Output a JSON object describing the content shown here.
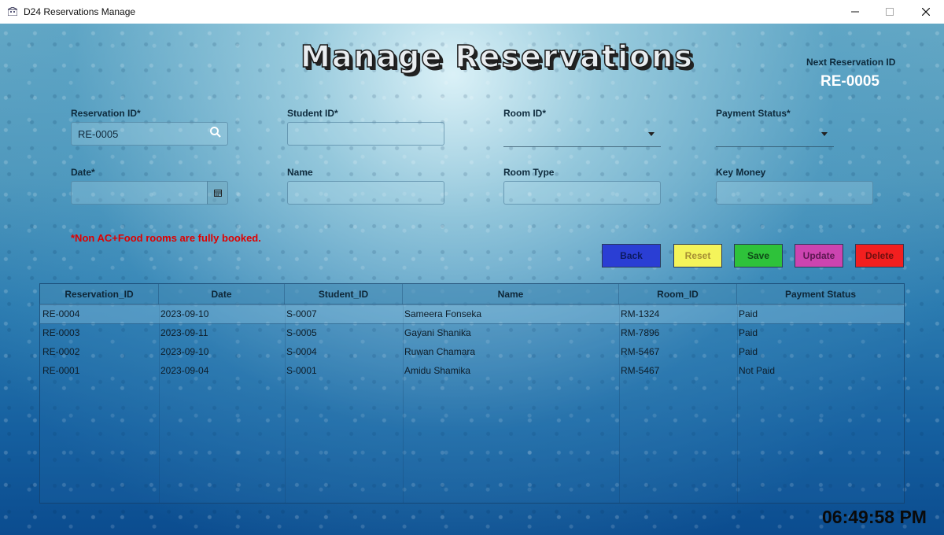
{
  "window": {
    "title": "D24 Reservations Manage"
  },
  "header": {
    "title": "Manage Reservations",
    "next_reservation_label": "Next Reservation ID",
    "next_reservation_value": "RE-0005"
  },
  "form": {
    "reservation_id": {
      "label": "Reservation ID*",
      "value": "RE-0005"
    },
    "student_id": {
      "label": "Student ID*",
      "value": ""
    },
    "room_id": {
      "label": "Room ID*",
      "value": ""
    },
    "payment_status": {
      "label": "Payment Status*",
      "value": ""
    },
    "date": {
      "label": "Date*",
      "value": ""
    },
    "name": {
      "label": "Name",
      "value": ""
    },
    "room_type": {
      "label": "Room Type",
      "value": ""
    },
    "key_money": {
      "label": "Key Money",
      "value": ""
    }
  },
  "warning": "*Non AC+Food rooms are fully booked.",
  "buttons": {
    "back": "Back",
    "reset": "Reset",
    "save": "Save",
    "update": "Update",
    "delete": "Delete"
  },
  "table": {
    "columns": [
      "Reservation_ID",
      "Date",
      "Student_ID",
      "Name",
      "Room_ID",
      "Payment Status"
    ],
    "rows": [
      [
        "RE-0004",
        "2023-09-10",
        "S-0007",
        "Sameera Fonseka",
        "RM-1324",
        "Paid"
      ],
      [
        "RE-0003",
        "2023-09-11",
        "S-0005",
        "Gayani Shanika",
        "RM-7896",
        "Paid"
      ],
      [
        "RE-0002",
        "2023-09-10",
        "S-0004",
        "Ruwan Chamara",
        "RM-5467",
        "Paid"
      ],
      [
        "RE-0001",
        "2023-09-04",
        "S-0001",
        "Amidu Shamika",
        "RM-5467",
        "Not Paid"
      ]
    ]
  },
  "clock": "06:49:58 PM"
}
